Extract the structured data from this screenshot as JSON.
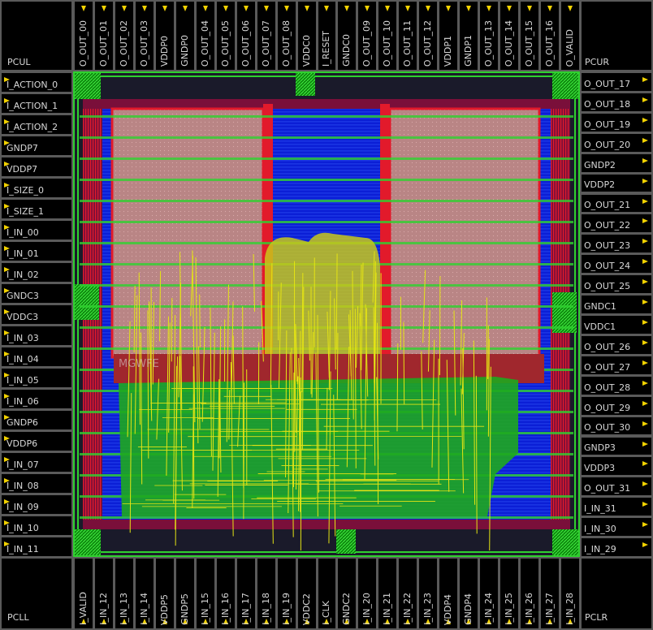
{
  "corners": {
    "ul": "PCUL",
    "ur": "PCUR",
    "ll": "PCLL",
    "lr": "PCLR"
  },
  "top_pads": [
    "O_OUT_00",
    "O_OUT_01",
    "O_OUT_02",
    "O_OUT_03",
    "VDDP0",
    "GNDP0",
    "O_OUT_04",
    "O_OUT_05",
    "O_OUT_06",
    "O_OUT_07",
    "O_OUT_08",
    "VDDC0",
    "I_RESET",
    "GNDC0",
    "O_OUT_09",
    "O_OUT_10",
    "O_OUT_11",
    "O_OUT_12",
    "VDDP1",
    "GNDP1",
    "O_OUT_13",
    "O_OUT_14",
    "O_OUT_15",
    "O_OUT_16",
    "O_VALID"
  ],
  "bottom_pads": [
    "I_VALID",
    "I_IN_12",
    "I_IN_13",
    "I_IN_14",
    "VDDP5",
    "GNDP5",
    "I_IN_15",
    "I_IN_16",
    "I_IN_17",
    "I_IN_18",
    "I_IN_19",
    "VDDC2",
    "I_CLK",
    "GNDC2",
    "I_IN_20",
    "I_IN_21",
    "I_IN_22",
    "I_IN_23",
    "VDDP4",
    "GNDP4",
    "I_IN_24",
    "I_IN_25",
    "I_IN_26",
    "I_IN_27",
    "I_IN_28"
  ],
  "left_pads": [
    "I_ACTION_0",
    "I_ACTION_1",
    "I_ACTION_2",
    "GNDP7",
    "VDDP7",
    "I_SIZE_0",
    "I_SIZE_1",
    "I_IN_00",
    "I_IN_01",
    "I_IN_02",
    "GNDC3",
    "VDDC3",
    "I_IN_03",
    "I_IN_04",
    "I_IN_05",
    "I_IN_06",
    "GNDP6",
    "VDDP6",
    "I_IN_07",
    "I_IN_08",
    "I_IN_09",
    "I_IN_10",
    "I_IN_11"
  ],
  "right_pads": [
    "O_OUT_17",
    "O_OUT_18",
    "O_OUT_19",
    "O_OUT_20",
    "GNDP2",
    "VDDP2",
    "O_OUT_21",
    "O_OUT_22",
    "O_OUT_23",
    "O_OUT_24",
    "O_OUT_25",
    "GNDC1",
    "VDDC1",
    "O_OUT_26",
    "O_OUT_27",
    "O_OUT_28",
    "O_OUT_29",
    "O_OUT_30",
    "GNDP3",
    "VDDP3",
    "O_OUT_31",
    "I_IN_31",
    "I_IN_30",
    "I_IN_29"
  ],
  "macro_label": "MGWFE",
  "colors": {
    "core_blue": "#0b1fd6",
    "ring_red": "#e21a2b",
    "macro": "#b98585",
    "wire_green": "#2fd12f",
    "wire_yellow": "#e4e414",
    "via_green": "#1ea81e",
    "pad_arrow": "#f2d200"
  }
}
